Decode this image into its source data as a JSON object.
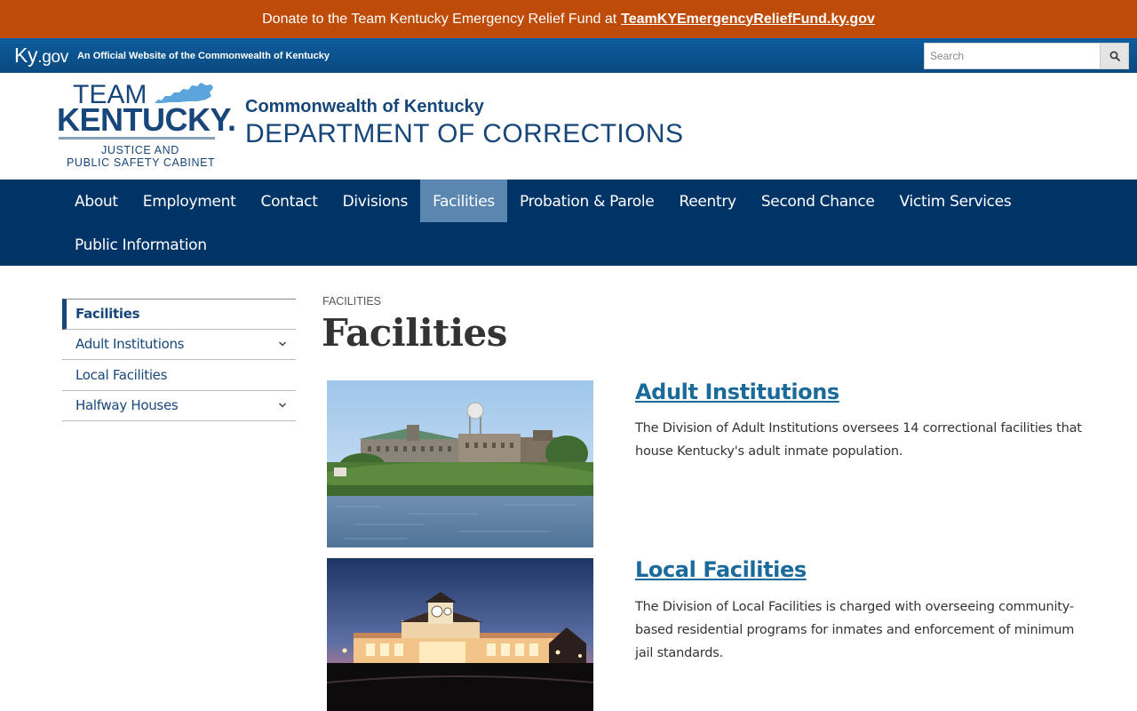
{
  "donate_bar": {
    "text": "Donate to the Team Kentucky Emergency Relief Fund at",
    "link": "TeamKYEmergencyReliefFund.ky.gov"
  },
  "kygov_bar": {
    "logo_ky": "Ky",
    "logo_gov": ".gov",
    "tagline": "An Official Website of the Commonwealth of Kentucky",
    "search_placeholder": "Search",
    "search_icon": "search-icon"
  },
  "header": {
    "logo": {
      "team": "TEAM",
      "kentucky": "KENTUCKY.",
      "line1": "JUSTICE AND",
      "line2": "PUBLIC SAFETY CABINET"
    },
    "commonwealth": "Commonwealth of Kentucky",
    "department": "DEPARTMENT OF CORRECTIONS"
  },
  "main_nav": {
    "items": [
      "About",
      "Employment",
      "Contact",
      "Divisions",
      "Facilities",
      "Probation & Parole",
      "Reentry",
      "Second Chance",
      "Victim Services",
      "Public Information"
    ],
    "active": "Facilities"
  },
  "side_nav": {
    "items": [
      {
        "label": "Facilities",
        "expandable": false
      },
      {
        "label": "Adult Institutions",
        "expandable": true
      },
      {
        "label": "Local Facilities",
        "expandable": false
      },
      {
        "label": "Halfway Houses",
        "expandable": true
      }
    ],
    "chevron_icon": "chevron-down-icon"
  },
  "content": {
    "breadcrumb": "FACILITIES",
    "title": "Facilities",
    "cards": [
      {
        "title": "Adult Institutions",
        "description": "The Division of Adult Institutions oversees 14 correctional facilities that house Kentucky's adult inmate population.",
        "image": "prison-on-river-photo"
      },
      {
        "title": "Local Facilities",
        "description": "The Division of Local Facilities is charged with overseeing community-based residential programs for inmates and enforcement of minimum jail standards.",
        "image": "night-building-photo"
      }
    ]
  },
  "colors": {
    "donate_bg": "#bf4b08",
    "kygov_bg": "#0d5c9c",
    "nav_bg": "#003366",
    "nav_active": "#5b86b0",
    "brand_blue": "#17477a",
    "link_blue": "#1a6a9c"
  }
}
